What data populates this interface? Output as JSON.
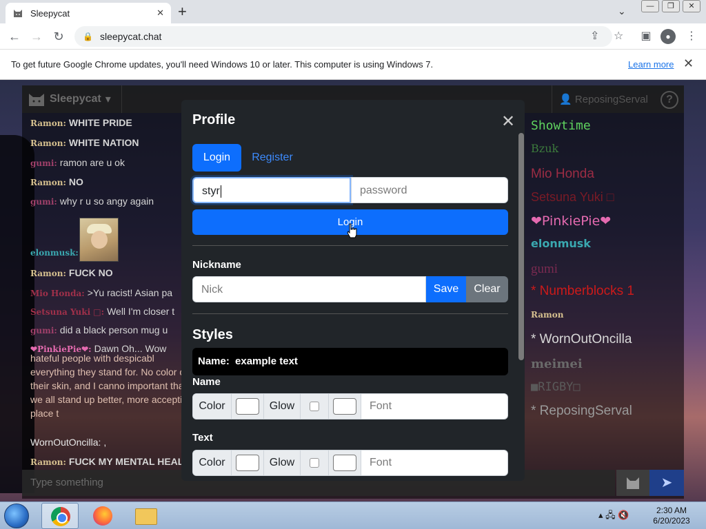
{
  "browser": {
    "tab_title": "Sleepycat",
    "url": "sleepycat.chat",
    "new_tab_glyph": "+",
    "infobar": {
      "message": "To get future Google Chrome updates, you'll need Windows 10 or later. This computer is using Windows 7.",
      "link": "Learn more"
    }
  },
  "app": {
    "brand": "Sleepycat",
    "username": "ReposingServal",
    "help_glyph": "?",
    "input_placeholder": "Type something",
    "messages": [
      {
        "nick": "Ramon:",
        "text": "WHITE PRIDE",
        "nick_color": "#d6c08f",
        "bold": true
      },
      {
        "nick": "Ramon:",
        "text": "WHITE NATION",
        "nick_color": "#d6c08f",
        "bold": true
      },
      {
        "nick": "gumi:",
        "text": "ramon are u ok",
        "nick_color": "#a0406a",
        "bold": false
      },
      {
        "nick": "Ramon:",
        "text": "NO",
        "nick_color": "#d6c08f",
        "bold": true
      },
      {
        "nick": "gumi:",
        "text": "why r u so angy again",
        "nick_color": "#a0406a",
        "bold": false
      },
      {
        "nick": "elonmusk:",
        "text": "",
        "nick_color": "#3aa8b0",
        "bold": true
      },
      {
        "nick": "Ramon:",
        "text": "FUCK NO",
        "nick_color": "#d6c08f",
        "bold": true
      },
      {
        "nick": "Mio Honda:",
        "text": ">Yu racist! Asian pa",
        "nick_color": "#a0304a",
        "bold": false
      },
      {
        "nick": "Setsuna Yuki □:",
        "text": "Well I'm closer t",
        "nick_color": "#a0304a",
        "bold": false
      },
      {
        "nick": "gumi:",
        "text": "did a black person mug u",
        "nick_color": "#a0406a",
        "bold": false
      },
      {
        "nick": "❤PinkiePie❤:",
        "text": "Dawn Oh... Wow",
        "nick_color": "#e46ab0",
        "bold": false
      }
    ],
    "long_message": "hateful people with despicabl everything they stand for. No color of their skin, and I canno important that we all stand up better, more accepting place t",
    "wornout_line": "WornOutOncilla: ,",
    "last_message": {
      "nick": "Ramon:",
      "text": "FUCK MY MENTAL HEALTH"
    },
    "users": [
      {
        "name": "Showtime",
        "color": "#5fd35f"
      },
      {
        "name": "Bzuk",
        "color": "#3c7a3c"
      },
      {
        "name": "Mio Honda",
        "color": "#9c2c44"
      },
      {
        "name": "Setsuna Yuki □",
        "color": "#7a1a26"
      },
      {
        "name": "❤PinkiePie❤",
        "color": "#e46ab0"
      },
      {
        "name": "elonmusk",
        "color": "#3aa8b0"
      },
      {
        "name": "gumi",
        "color": "#7a2a50"
      },
      {
        "name": "* Numberblocks 1",
        "color": "#cc1a1a"
      },
      {
        "name": "Ramon",
        "color": "#d6c08f"
      },
      {
        "name": "* WornOutOncilla",
        "color": "#d8d8d8"
      },
      {
        "name": "meimei",
        "color": "#6a6a6a"
      },
      {
        "name": "■RIGBY□",
        "color": "#5a5a5a"
      },
      {
        "name": "* ReposingServal",
        "color": "#9a9a9a"
      }
    ]
  },
  "modal": {
    "title": "Profile",
    "tabs": {
      "login": "Login",
      "register": "Register"
    },
    "username_value": "styr",
    "password_placeholder": "password",
    "login_button": "Login",
    "nickname_label": "Nickname",
    "nick_placeholder": "Nick",
    "save_button": "Save",
    "clear_button": "Clear",
    "styles_heading": "Styles",
    "preview": {
      "name": "Name:",
      "text": "example text"
    },
    "name_section": "Name",
    "text_section": "Text",
    "row": {
      "color": "Color",
      "glow": "Glow",
      "font_placeholder": "Font"
    }
  },
  "taskbar": {
    "time": "2:30 AM",
    "date": "6/20/2023"
  }
}
